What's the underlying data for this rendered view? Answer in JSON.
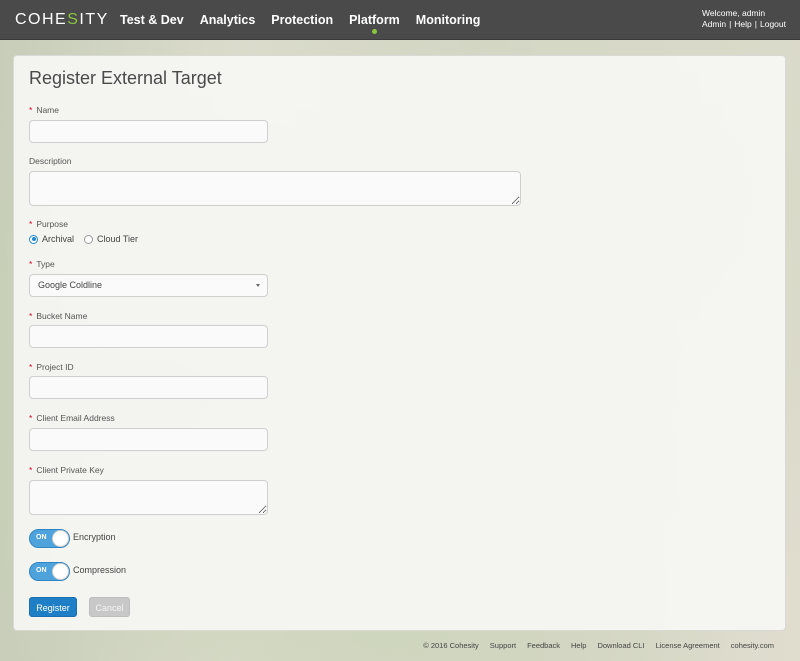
{
  "header": {
    "logo_left": "COHE",
    "logo_accent": "S",
    "logo_right": "ITY",
    "nav": [
      "Test & Dev",
      "Analytics",
      "Protection",
      "Platform",
      "Monitoring"
    ],
    "active_nav": "Platform",
    "welcome": "Welcome, admin",
    "links": [
      "Admin",
      "Help",
      "Logout"
    ],
    "separator": "|"
  },
  "form": {
    "title": "Register External Target",
    "required_marker": "*",
    "name_label": "Name",
    "name_value": "",
    "description_label": "Description",
    "description_value": "",
    "purpose_label": "Purpose",
    "purpose_options": [
      "Archival",
      "Cloud Tier"
    ],
    "purpose_selected": "Archival",
    "type_label": "Type",
    "type_value": "Google Coldline",
    "bucket_label": "Bucket Name",
    "bucket_value": "",
    "project_label": "Project ID",
    "project_value": "",
    "email_label": "Client Email Address",
    "email_value": "",
    "key_label": "Client Private Key",
    "key_value": "",
    "encryption_state": "ON",
    "encryption_label": "Encryption",
    "compression_state": "ON",
    "compression_label": "Compression",
    "register_label": "Register",
    "cancel_label": "Cancel"
  },
  "footer": {
    "copyright": "© 2016 Cohesity",
    "links": [
      "Support",
      "Feedback",
      "Help",
      "Download CLI",
      "License Agreement",
      "cohesity.com"
    ]
  },
  "colors": {
    "topbar": "#4a4a4a",
    "accent_green": "#8cc63f",
    "primary_blue": "#1f7fc6",
    "required_red": "#d0021b"
  }
}
